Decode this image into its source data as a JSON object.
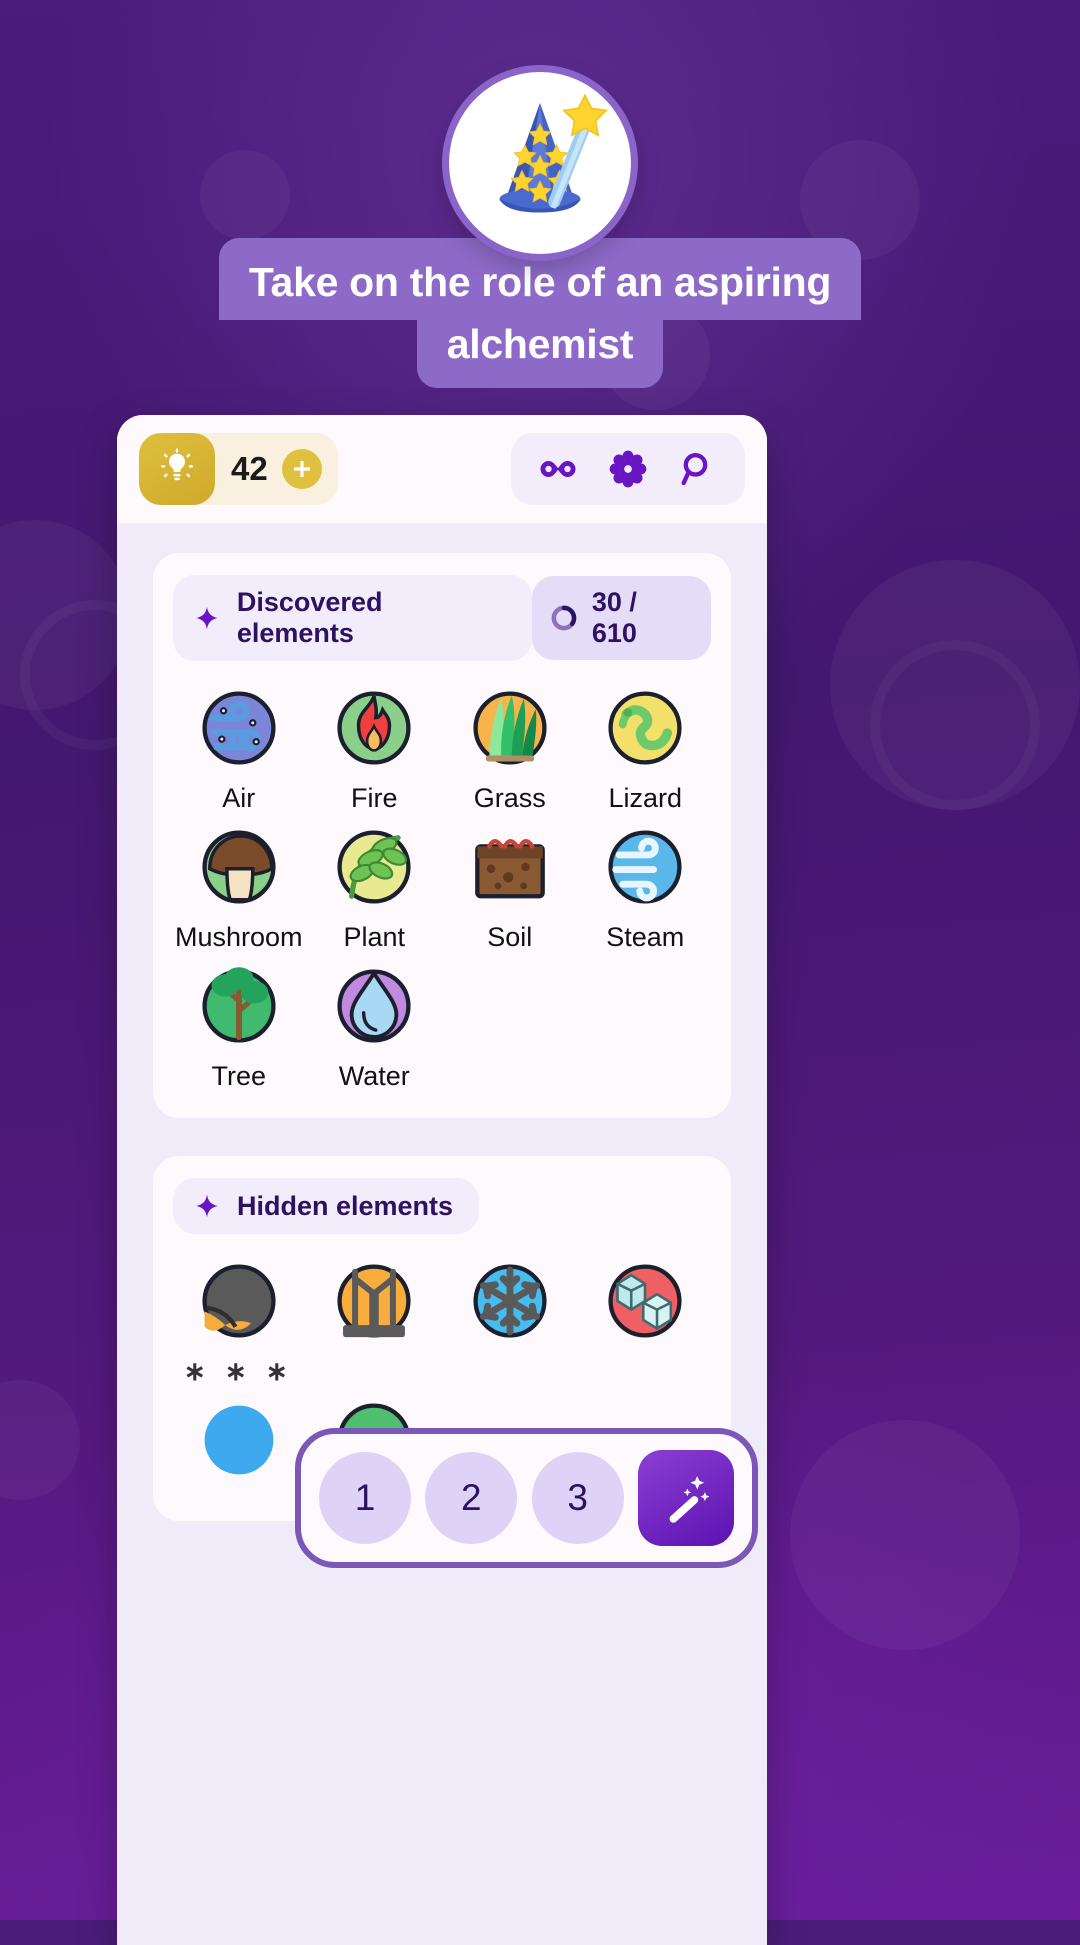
{
  "app": {
    "icon_name": "wizard-hat-wand-icon",
    "tagline_line1": "Take on the role of an aspiring",
    "tagline_line2": "alchemist"
  },
  "colors": {
    "background_purple": "#4a1d7a",
    "tagline_chip": "#8d6ac8",
    "card_bg": "#f0ebf8",
    "panel_bg": "#fdf9fd",
    "accent_purple": "#5c12b0",
    "hint_gold": "#dfc03f",
    "numpad_border": "#7a58b8"
  },
  "toolbar": {
    "hint_icon": "lightbulb-icon",
    "hint_count": "42",
    "add_hint_icon": "plus-icon",
    "buttons": [
      {
        "name": "infinity-icon",
        "label": "∞"
      },
      {
        "name": "gear-icon",
        "label": "settings"
      },
      {
        "name": "search-icon",
        "label": "search"
      }
    ]
  },
  "discovered": {
    "star_icon": "sparkle-icon",
    "title": "Discovered elements",
    "progress_icon": "progress-ring-icon",
    "progress": "30 / 610",
    "found": 30,
    "total": 610,
    "items": [
      {
        "label": "Air",
        "art": "air"
      },
      {
        "label": "Fire",
        "art": "fire"
      },
      {
        "label": "Grass",
        "art": "grass"
      },
      {
        "label": "Lizard",
        "art": "lizard"
      },
      {
        "label": "Mushroom",
        "art": "mushroom"
      },
      {
        "label": "Plant",
        "art": "plant"
      },
      {
        "label": "Soil",
        "art": "soil"
      },
      {
        "label": "Steam",
        "art": "steam"
      },
      {
        "label": "Tree",
        "art": "tree"
      },
      {
        "label": "Water",
        "art": "water"
      }
    ]
  },
  "hidden": {
    "star_icon": "sparkle-icon",
    "title": "Hidden elements",
    "items": [
      {
        "label": "∗ ∗ ∗",
        "art": "cave"
      },
      {
        "label": "",
        "art": "bridge"
      },
      {
        "label": "",
        "art": "snowflake"
      },
      {
        "label": "",
        "art": "ice-cubes"
      },
      {
        "label": "",
        "art": "blue-orb"
      },
      {
        "label": "",
        "art": "green-orb"
      }
    ]
  },
  "numpad": {
    "keys": [
      "1",
      "2",
      "3"
    ],
    "magic_button_icon": "magic-wand-icon"
  }
}
